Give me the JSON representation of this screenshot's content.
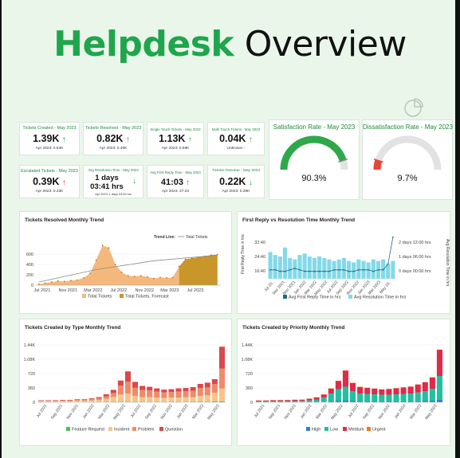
{
  "header": {
    "title_green": "Helpdesk",
    "title_black": " Overview"
  },
  "kpis": [
    {
      "label": "Tickets Created - May 2023",
      "value": "1.39K",
      "arrow": "↑",
      "arrow_dir": "up",
      "sub": "Apr 2023: 0.63K"
    },
    {
      "label": "Tickets Resolved - May 2023",
      "value": "0.82K",
      "arrow": "↑",
      "arrow_dir": "up",
      "sub": "Apr 2023: 0.45K"
    },
    {
      "label": "Single Touch Tickets - May 2023",
      "value": "1.13K",
      "arrow": "↑",
      "arrow_dir": "up",
      "sub": "Apr 2023: 0.59K"
    },
    {
      "label": "Multi Touch Tickets - May 2023",
      "value": "0.04K",
      "arrow": "↑",
      "arrow_dir": "up",
      "sub": "Unknown -"
    },
    {
      "label": "Escalated Tickets - May 2023",
      "value": "0.39K",
      "arrow": "↑",
      "arrow_dir": "down",
      "sub": "Apr 2023: 0.33K"
    },
    {
      "label": "Avg Resolution Time - May 2023",
      "value": "1 days",
      "value2": "03:41 hrs",
      "arrow": "↓",
      "arrow_dir": "good",
      "sub": "Apr 2023: 1 days 03:49 hrs"
    },
    {
      "label": "Avg First Reply Time - May 2023",
      "value": "41:03",
      "arrow": "↑",
      "arrow_dir": "up",
      "sub": "Apr 2023: 27:23"
    },
    {
      "label": "Tickets Overdue - May 2023",
      "value": "0.22K",
      "arrow": "↓",
      "arrow_dir": "good",
      "sub": "Apr 2023: 0.38K"
    }
  ],
  "gauges": [
    {
      "title": "Satisfaction Rate - May 2023",
      "value_label": "90.3%",
      "value": 90.3,
      "color": "#2ea84a"
    },
    {
      "title": "Dissatisfaction Rate - May 2023",
      "value_label": "9.7%",
      "value": 9.7,
      "color": "#e8443a"
    }
  ],
  "colors": {
    "green": "#1fa64d",
    "orange_light": "#f5b87c",
    "orange_dark": "#c9962c",
    "teal_dark": "#1f6e7c",
    "teal_light": "#84d9e8",
    "type_feature": "#4cbf5a",
    "type_incident": "#f8c48a",
    "type_problem": "#f08a6a",
    "type_question": "#d9484c",
    "pri_high": "#2f7fd6",
    "pri_low": "#22c0a0",
    "pri_medium": "#e02a4a",
    "pri_urgent": "#f07a1a"
  },
  "chart_data": [
    {
      "type": "area",
      "title": "Tickets Resolved Monthly Trend",
      "trend_legend_label": "Trend Line:",
      "trend_legend_series": "Total Tickets",
      "x_ticks": [
        "Jul 2021",
        "Nov 2021",
        "Mar 2022",
        "Jul 2022",
        "Nov 2022",
        "Mar 2023",
        "Jul 2023"
      ],
      "y_ticks": [
        "0",
        "200",
        "400",
        "600"
      ],
      "ylim": [
        0,
        800
      ],
      "x_range": [
        "2021-06-01",
        "2023-10-31"
      ],
      "series": [
        {
          "name": "Total Tickets",
          "x": [
            "2021-06-15",
            "2021-07-15",
            "2021-08-15",
            "2021-09-15",
            "2021-10-15",
            "2021-11-15",
            "2021-12-15",
            "2022-01-15",
            "2022-02-15",
            "2022-03-15",
            "2022-04-15",
            "2022-05-15",
            "2022-06-15",
            "2022-07-15",
            "2022-08-15",
            "2022-09-15",
            "2022-10-15",
            "2022-11-15",
            "2022-12-15",
            "2023-01-15",
            "2023-02-15",
            "2023-03-15",
            "2023-04-15"
          ],
          "values": [
            20,
            40,
            60,
            80,
            70,
            90,
            100,
            140,
            230,
            480,
            770,
            720,
            400,
            250,
            180,
            170,
            180,
            160,
            130,
            150,
            140,
            145,
            360
          ]
        },
        {
          "name": "Total Tickets, Forecast",
          "x": [
            "2023-04-15",
            "2023-05-15",
            "2023-06-15",
            "2023-07-15",
            "2023-08-15",
            "2023-09-15",
            "2023-10-15"
          ],
          "values": [
            360,
            500,
            520,
            540,
            560,
            580,
            590
          ]
        }
      ],
      "trend": {
        "name": "Total Tickets",
        "x": [
          "2021-06-15",
          "2022-03-15",
          "2022-12-15",
          "2023-10-15"
        ],
        "values": [
          60,
          300,
          470,
          580
        ]
      }
    },
    {
      "type": "bar",
      "title": "First Reply vs Resolution Time Monthly Trend",
      "categories": [
        "Jul 20..",
        "Sep 2021",
        "Nov 2021",
        "Jan 2022",
        "Mar 2022",
        "May 2022",
        "Jul 2022",
        "Sep 2022",
        "Nov 2022",
        "Jan 2023",
        "Mar 2023",
        "May 20.."
      ],
      "y_ticks_left": [
        "16:40",
        "24:40",
        "32:40"
      ],
      "y_ticks_right": [
        "0 days 00:00 hrs",
        "1 days 06:00 hrs",
        "2 days 12:00 hrs"
      ],
      "ylabel_left": "First Reply Time in hrs",
      "ylabel_right": "Avg Resolution Time in hrs",
      "series": [
        {
          "name": "Avg First Reply Time in hrs",
          "values": [
            20,
            20,
            19,
            19,
            20,
            21,
            20,
            19,
            19,
            19,
            19,
            19,
            19,
            20,
            20,
            20,
            19,
            19,
            20,
            20,
            20,
            19,
            20,
            20,
            24,
            42
          ]
        },
        {
          "name": "Avg Resolution Time in hrs",
          "values": [
            1.8,
            1.6,
            1.5,
            2.1,
            1.4,
            1.3,
            1.6,
            1.7,
            1.5,
            1.4,
            1.5,
            1.4,
            1.3,
            1.2,
            1.3,
            1.4,
            1.2,
            1.1,
            1.3,
            1.2,
            1.1,
            1.3,
            1.2,
            1.3,
            1.0,
            1.2
          ]
        }
      ]
    },
    {
      "type": "bar",
      "title": "Tickets Created by Type Monthly Trend",
      "x_ticks": [
        "Jul 2021",
        "Sep 2021",
        "Nov 2021",
        "Jan 2022",
        "Mar 2022",
        "May 2022",
        "Jul 2022",
        "Sep 2022",
        "Nov 2022",
        "Jan 2023",
        "Mar 2023",
        "May 2023"
      ],
      "y_ticks": [
        "0",
        "360",
        "720",
        "1.08K",
        "1.44K"
      ],
      "ylim": [
        0,
        1440
      ],
      "series": [
        {
          "name": "Feature Request",
          "values": [
            5,
            5,
            5,
            5,
            5,
            5,
            5,
            8,
            8,
            10,
            12,
            15,
            15,
            12,
            10,
            8,
            8,
            8,
            8,
            8,
            8,
            10,
            10,
            12,
            20,
            25
          ]
        },
        {
          "name": "Incident",
          "values": [
            20,
            20,
            22,
            25,
            25,
            30,
            30,
            40,
            50,
            80,
            120,
            180,
            200,
            150,
            120,
            120,
            110,
            100,
            110,
            110,
            120,
            120,
            150,
            160,
            220,
            320
          ]
        },
        {
          "name": "Problem",
          "values": [
            15,
            15,
            18,
            20,
            20,
            25,
            25,
            30,
            40,
            60,
            100,
            220,
            300,
            200,
            180,
            170,
            150,
            140,
            140,
            150,
            150,
            160,
            200,
            200,
            220,
            500
          ]
        },
        {
          "name": "Question",
          "values": [
            10,
            10,
            10,
            10,
            10,
            15,
            15,
            20,
            30,
            50,
            80,
            130,
            260,
            150,
            100,
            90,
            80,
            70,
            70,
            80,
            80,
            90,
            100,
            120,
            120,
            550
          ]
        }
      ]
    },
    {
      "type": "bar",
      "title": "Tickets Created by Priority Monthly Trend",
      "x_ticks": [
        "Jul 2021",
        "Sep 2021",
        "Nov 2021",
        "Jan 2022",
        "Mar 2022",
        "May 2022",
        "Jul 2022",
        "Sep 2022",
        "Nov 2022",
        "Jan 2023",
        "Mar 2023",
        "May 2023"
      ],
      "y_ticks": [
        "0",
        "360",
        "720",
        "1.08K",
        "1.44K"
      ],
      "ylim": [
        0,
        1440
      ],
      "series": [
        {
          "name": "High",
          "values": [
            5,
            5,
            5,
            5,
            5,
            5,
            5,
            8,
            10,
            15,
            20,
            30,
            40,
            30,
            20,
            20,
            20,
            20,
            20,
            20,
            20,
            20,
            25,
            30,
            40,
            60
          ]
        },
        {
          "name": "Low",
          "values": [
            20,
            20,
            20,
            22,
            25,
            25,
            30,
            40,
            60,
            100,
            200,
            300,
            350,
            250,
            200,
            190,
            180,
            170,
            170,
            180,
            190,
            200,
            220,
            250,
            300,
            600
          ]
        },
        {
          "name": "Medium",
          "values": [
            20,
            20,
            25,
            25,
            25,
            30,
            30,
            40,
            50,
            80,
            120,
            200,
            400,
            200,
            160,
            150,
            140,
            130,
            140,
            150,
            160,
            170,
            200,
            220,
            280,
            650
          ]
        },
        {
          "name": "Urgent",
          "values": [
            5,
            5,
            5,
            5,
            5,
            5,
            5,
            5,
            5,
            5,
            8,
            10,
            10,
            8,
            8,
            5,
            5,
            5,
            5,
            5,
            5,
            5,
            5,
            5,
            8,
            15
          ]
        }
      ]
    }
  ]
}
